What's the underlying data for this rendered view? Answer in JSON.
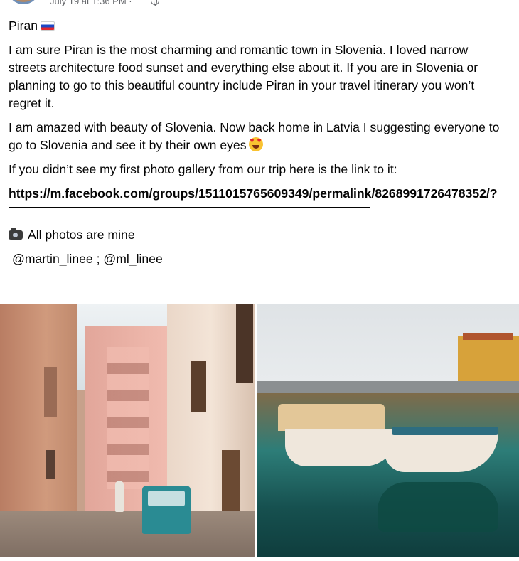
{
  "header": {
    "timestamp": "July 19 at 1:36 PM ·",
    "privacy_icon": "globe-icon"
  },
  "post": {
    "title": "Piran",
    "title_flag": "slovenia-flag",
    "paragraph_1": "I am sure Piran is the most charming and romantic town in Slovenia. I loved narrow streets architecture food sunset and everything else about it. If you are in Slovenia or planning to go to this beautiful country include Piran in your travel itinerary you won’t regret it.",
    "paragraph_2": "I am amazed with beauty of Slovenia. Now back home in Latvia I suggesting everyone to go to Slovenia and see it by their own eyes",
    "paragraph_2_emoji": "heart-eyes-emoji",
    "paragraph_3": "If you didn’t see my first photo gallery from our trip here is the link to it:",
    "link": "https://m.facebook.com/groups/1511015765609349/permalink/8268991726478352/?",
    "photos_note": "All photos are mine",
    "photos_note_icon": "camera-icon",
    "handles": "@martin_linee ; @ml_linee"
  },
  "photos": [
    {
      "subject": "narrow-street-photo"
    },
    {
      "subject": "harbor-boats-photo"
    }
  ]
}
